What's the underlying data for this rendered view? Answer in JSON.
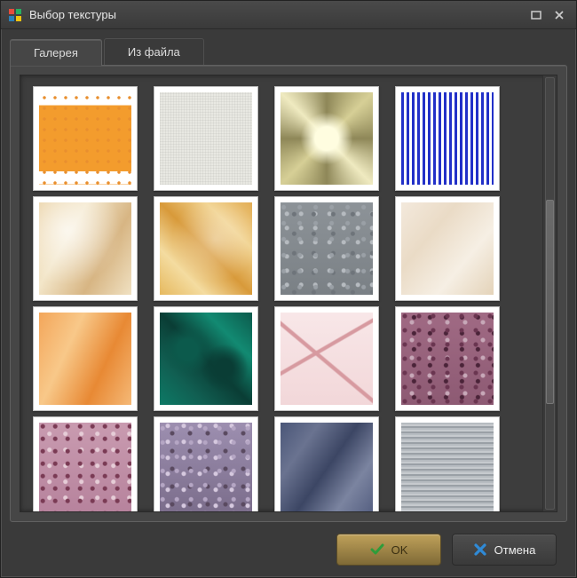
{
  "window": {
    "title": "Выбор текстуры"
  },
  "tabs": {
    "gallery": "Галерея",
    "from_file": "Из файла",
    "active": "gallery"
  },
  "textures": [
    {
      "id": "orange-dots"
    },
    {
      "id": "linen"
    },
    {
      "id": "metal-star"
    },
    {
      "id": "blue-stripes"
    },
    {
      "id": "marble-cream"
    },
    {
      "id": "marble-amber"
    },
    {
      "id": "granite-grey"
    },
    {
      "id": "marble-pale"
    },
    {
      "id": "marble-orange"
    },
    {
      "id": "malachite"
    },
    {
      "id": "marble-pink"
    },
    {
      "id": "granite-rose"
    },
    {
      "id": "granite-pink"
    },
    {
      "id": "granite-violet"
    },
    {
      "id": "marble-blue"
    },
    {
      "id": "brushed-steel"
    }
  ],
  "buttons": {
    "ok": "OK",
    "cancel": "Отмена"
  },
  "icons": {
    "check": "check-icon",
    "cross": "cross-icon",
    "maximize": "maximize-icon",
    "close": "close-icon"
  },
  "colors": {
    "window_bg": "#3a3a3a",
    "panel_bg": "#464646",
    "ok_button": "#a78a48",
    "cancel_button": "#444444"
  }
}
